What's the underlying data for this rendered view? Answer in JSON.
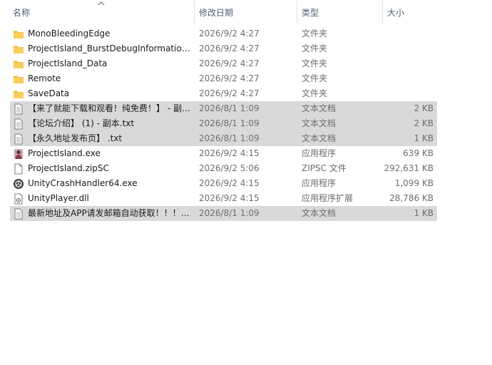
{
  "columns": {
    "name": "名称",
    "date": "修改日期",
    "type": "类型",
    "size": "大小"
  },
  "sort": {
    "column": "name",
    "icon": "chevron-up-icon"
  },
  "colors": {
    "header_text": "#4c607a",
    "selection": "#d9d9d9",
    "folder": "#f4c44d"
  },
  "files": [
    {
      "name": "MonoBleedingEdge",
      "date": "2026/9/2 4:27",
      "type": "文件夹",
      "size": "",
      "icon": "folder-icon",
      "selected": false
    },
    {
      "name": "ProjectIsland_BurstDebugInformation_DoNotShip",
      "date": "2026/9/2 4:27",
      "type": "文件夹",
      "size": "",
      "icon": "folder-icon",
      "selected": false
    },
    {
      "name": "ProjectIsland_Data",
      "date": "2026/9/2 4:27",
      "type": "文件夹",
      "size": "",
      "icon": "folder-icon",
      "selected": false
    },
    {
      "name": "Remote",
      "date": "2026/9/2 4:27",
      "type": "文件夹",
      "size": "",
      "icon": "folder-icon",
      "selected": false
    },
    {
      "name": "SaveData",
      "date": "2026/9/2 4:27",
      "type": "文件夹",
      "size": "",
      "icon": "folder-icon",
      "selected": false
    },
    {
      "name": "【来了就能下载和观看！纯免费！】 - 副本.txt",
      "date": "2026/8/1 1:09",
      "type": "文本文档",
      "size": "2 KB",
      "icon": "text-file-icon",
      "selected": true
    },
    {
      "name": "【论坛介绍】 (1) - 副本.txt",
      "date": "2026/8/1 1:09",
      "type": "文本文档",
      "size": "2 KB",
      "icon": "text-file-icon",
      "selected": true
    },
    {
      "name": "【永久地址发布页】 .txt",
      "date": "2026/8/1 1:09",
      "type": "文本文档",
      "size": "1 KB",
      "icon": "text-file-icon",
      "selected": true
    },
    {
      "name": "ProjectIsland.exe",
      "date": "2026/9/2 4:15",
      "type": "应用程序",
      "size": "639 KB",
      "icon": "app-exe-icon",
      "selected": false
    },
    {
      "name": "ProjectIsland.zipSC",
      "date": "2026/9/2 5:06",
      "type": "ZIPSC 文件",
      "size": "292,631 KB",
      "icon": "blank-file-icon",
      "selected": false
    },
    {
      "name": "UnityCrashHandler64.exe",
      "date": "2026/9/2 4:15",
      "type": "应用程序",
      "size": "1,099 KB",
      "icon": "unity-icon",
      "selected": false
    },
    {
      "name": "UnityPlayer.dll",
      "date": "2026/9/2 4:15",
      "type": "应用程序扩展",
      "size": "28,786 KB",
      "icon": "dll-file-icon",
      "selected": false
    },
    {
      "name": "最新地址及APP请发邮箱自动获取！！！.txt",
      "date": "2026/8/1 1:09",
      "type": "文本文档",
      "size": "1 KB",
      "icon": "text-file-icon",
      "selected": true
    }
  ]
}
